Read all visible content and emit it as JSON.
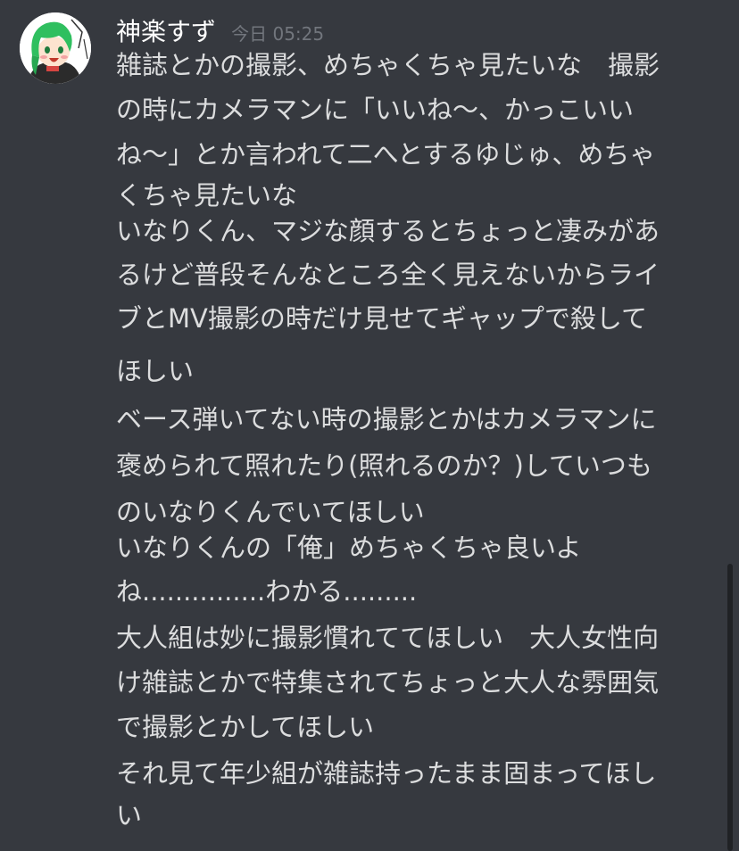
{
  "message": {
    "author": "神楽すず",
    "timestamp": "今日 05:25",
    "avatar_icon": "user-avatar-green-hair-character",
    "lines": [
      "雑誌とかの撮影、めちゃくちゃ見たいな　撮影",
      "の時にカメラマンに「いいね〜、かっこいい",
      "ね〜」とか言われて二へとするゆじゅ、めちゃ",
      "くちゃ見たいな",
      "いなりくん、マジな顔するとちょっと凄みがあ",
      "るけど普段そんなところ全く見えないからライ",
      "ブとMV撮影の時だけ見せてギャップで殺して",
      "ほしい",
      "ベース弾いてない時の撮影とかはカメラマンに",
      "褒められて照れたり(照れるのか？)していつも",
      "のいなりくんでいてほしい",
      "いなりくんの「俺」めちゃくちゃ良いよ",
      "ね...............わかる.........",
      "大人組は妙に撮影慣れててほしい　大人女性向",
      "け雑誌とかで特集されてちょっと大人な雰囲気",
      "で撮影とかしてほしい",
      "それ見て年少組が雑誌持ったまま固まってほし",
      "い"
    ]
  },
  "colors": {
    "background": "#36393f",
    "author": "#ffffff",
    "timestamp": "#72767d",
    "text": "#dcddde",
    "scrollbar": "#202225",
    "avatar_hair": "#2fbf5f"
  }
}
